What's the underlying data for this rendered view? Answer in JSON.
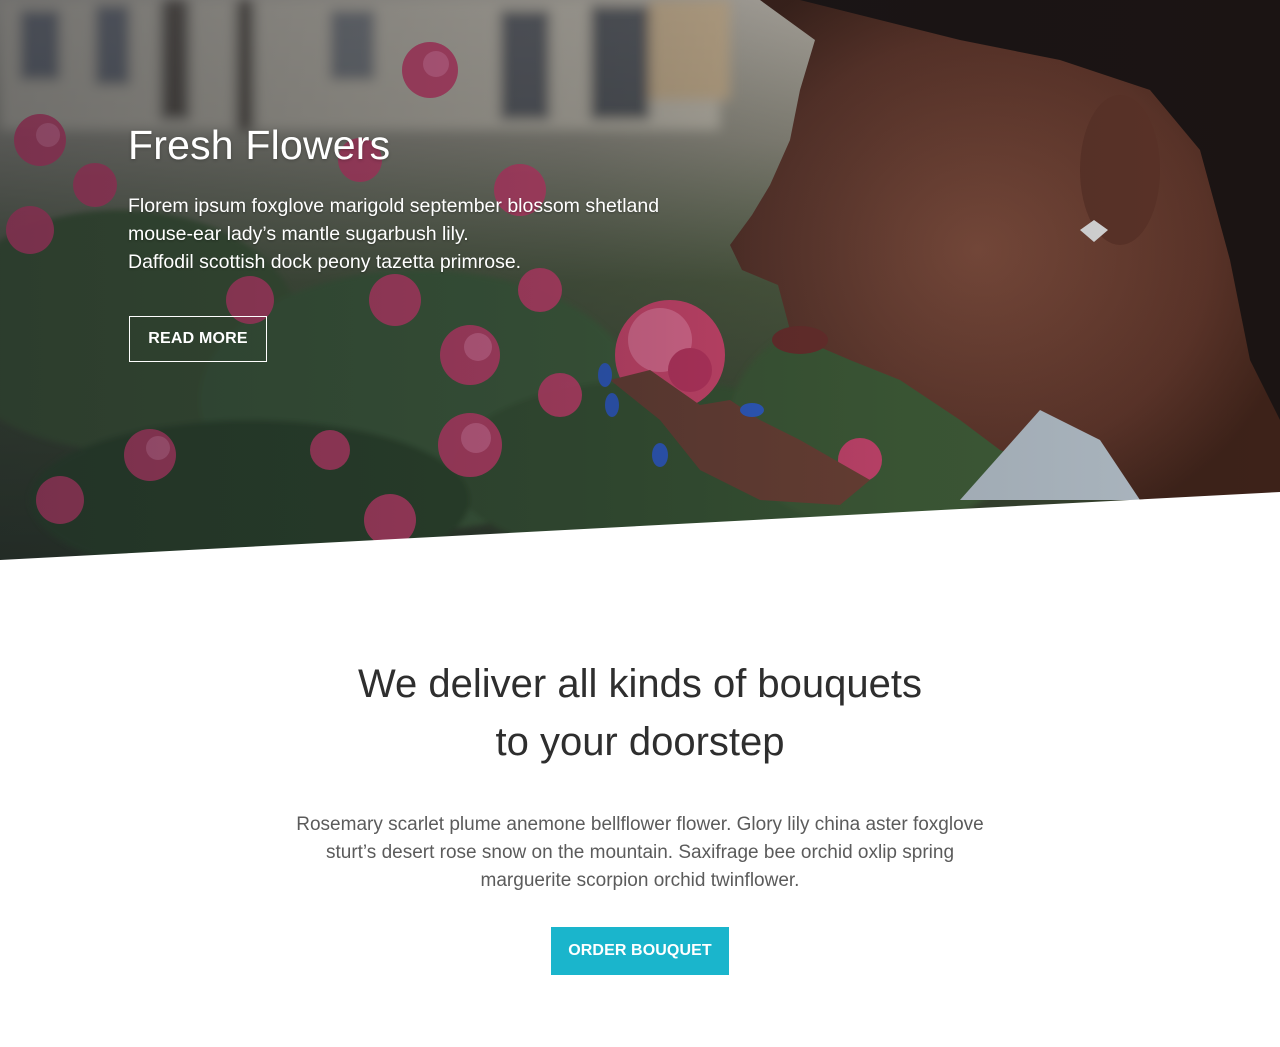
{
  "hero": {
    "title": "Fresh Flowers",
    "text_lines": [
      "Florem ipsum foxglove marigold september blossom shetland",
      "mouse-ear lady’s mantle sugarbush lily.",
      "Daffodil scottish dock peony tazetta primrose."
    ],
    "button_label": "READ MORE"
  },
  "section": {
    "title_lines": [
      "We deliver all kinds of bouquets",
      "to your doorstep"
    ],
    "text_lines": [
      "Rosemary scarlet plume anemone bellflower flower. Glory lily china aster foxglove",
      "sturt’s desert rose snow on the mountain. Saxifrage bee orchid oxlip spring",
      "marguerite scorpion orchid twinflower."
    ],
    "button_label": "ORDER BOUQUET"
  },
  "colors": {
    "accent": "#1ab5cc",
    "heading": "#2e2e2e",
    "body_text": "#5b5b5b"
  }
}
